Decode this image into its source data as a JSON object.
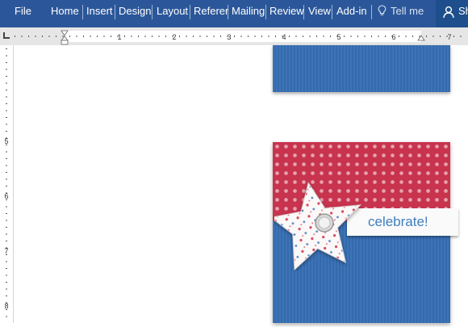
{
  "ribbon": {
    "tabs": [
      "File",
      "Home",
      "Insert",
      "Design",
      "Layout",
      "Referer",
      "Mailing",
      "Review",
      "View",
      "Add-in"
    ],
    "tell_me": "Tell me",
    "share_label": "Sh"
  },
  "ruler": {
    "numbers": [
      "1",
      "2",
      "3",
      "4",
      "5",
      "6",
      "7"
    ],
    "vertical_numbers": [
      "5",
      "6",
      "7",
      "8"
    ]
  },
  "document": {
    "card_text": "celebrate!"
  },
  "colors": {
    "ribbon": "#2b579a",
    "card_red": "#c8334e",
    "card_blue": "#3d74b8",
    "text_blue": "#3f7fbf"
  }
}
